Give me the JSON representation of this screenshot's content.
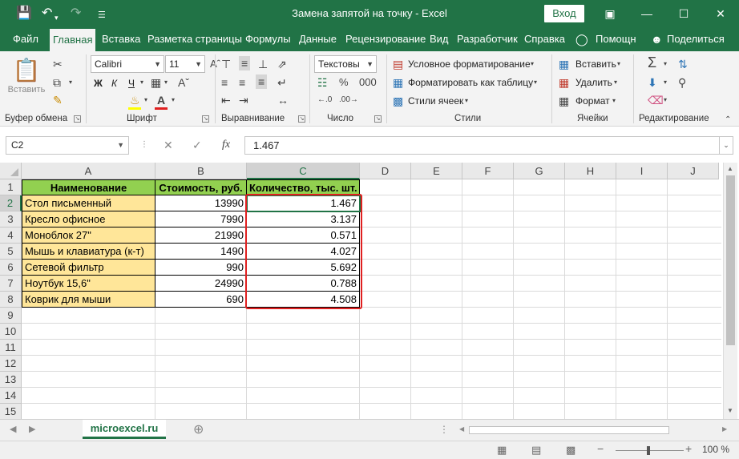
{
  "titlebar": {
    "title": "Замена запятой на точку  -  Excel",
    "login": "Вход",
    "icons": [
      "save-icon",
      "undo-icon",
      "redo-icon",
      "customize-icon"
    ]
  },
  "tabs": [
    "Файл",
    "Главная",
    "Вставка",
    "Разметка страницы",
    "Формулы",
    "Данные",
    "Рецензирование",
    "Вид",
    "Разработчик",
    "Справка",
    "Помощн",
    "Поделиться"
  ],
  "ribbon": {
    "clipboard": {
      "paste": "Вставить",
      "label": "Буфер обмена"
    },
    "font": {
      "name": "Calibri",
      "size": "11",
      "bold": "Ж",
      "italic": "К",
      "underline": "Ч",
      "label": "Шрифт"
    },
    "alignment": {
      "label": "Выравнивание"
    },
    "number": {
      "format": "Текстовы",
      "label": "Число"
    },
    "styles": {
      "conditional": "Условное форматирование",
      "as_table": "Форматировать как таблицу",
      "cell_styles": "Стили ячеек",
      "label": "Стили"
    },
    "cells": {
      "insert": "Вставить",
      "delete": "Удалить",
      "format": "Формат",
      "label": "Ячейки"
    },
    "editing": {
      "label": "Редактирование"
    }
  },
  "formula_bar": {
    "name_box": "C2",
    "fx": "fx",
    "value": "1.467"
  },
  "columns": [
    "A",
    "B",
    "C",
    "D",
    "E",
    "F",
    "G",
    "H",
    "I",
    "J"
  ],
  "rows": [
    "1",
    "2",
    "3",
    "4",
    "5",
    "6",
    "7",
    "8",
    "9",
    "10",
    "11",
    "12",
    "13",
    "14",
    "15"
  ],
  "table": {
    "headers": [
      "Наименование",
      "Стоимость, руб.",
      "Количество, тыс. шт."
    ],
    "data": [
      [
        "Стол письменный",
        "13990",
        "1.467"
      ],
      [
        "Кресло офисное",
        "7990",
        "3.137"
      ],
      [
        "Моноблок 27\"",
        "21990",
        "0.571"
      ],
      [
        "Мышь и клавиатура (к-т)",
        "1490",
        "4.027"
      ],
      [
        "Сетевой фильтр",
        "990",
        "5.692"
      ],
      [
        "Ноутбук 15,6\"",
        "24990",
        "0.788"
      ],
      [
        "Коврик для мыши",
        "690",
        "4.508"
      ]
    ]
  },
  "sheet_tab": "microexcel.ru",
  "status": {
    "zoom": "100 %"
  },
  "colors": {
    "accent": "#217346",
    "header_fill": "#92d050",
    "name_fill": "#ffe699",
    "highlight": "#e02020"
  }
}
